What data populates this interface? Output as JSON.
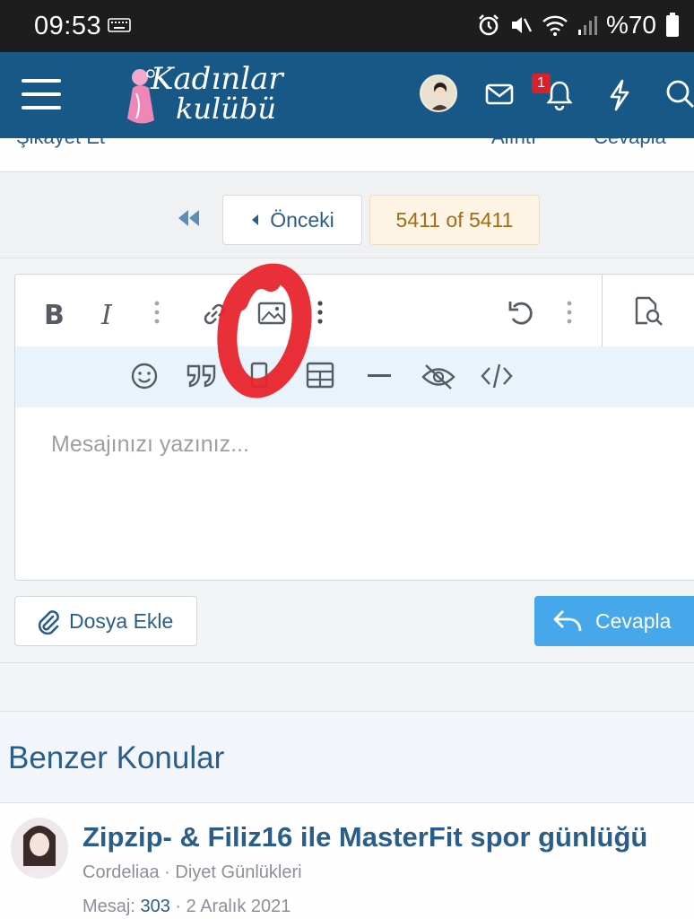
{
  "status_bar": {
    "time": "09:53",
    "battery_text": "%70",
    "icons": [
      "keyboard-icon",
      "alarm-icon",
      "mute-icon",
      "wifi-icon",
      "signal-icon",
      "battery-icon"
    ]
  },
  "header": {
    "logo_line1": "Kadınlar",
    "logo_line2": "kulübü",
    "notification_count": "1",
    "colors": {
      "background": "#185886",
      "badge": "#d9212c"
    }
  },
  "post_footer": {
    "report_label": "Şikayet Et",
    "quote_label": "Alıntı",
    "reply_label": "Cevapla"
  },
  "pagination": {
    "prev_label": "Önceki",
    "page_count": "5411 of 5411"
  },
  "editor": {
    "placeholder": "Mesajınızı yazınız...",
    "toolbar_row1": [
      "bold-icon",
      "italic-icon",
      "more-vertical-icon",
      "link-icon",
      "image-icon",
      "more-vertical-icon",
      "undo-icon",
      "more-vertical-icon",
      "preview-icon"
    ],
    "toolbar_row2": [
      "smiley-icon",
      "quote-icon",
      "media-icon",
      "table-icon",
      "horizontal-rule-icon",
      "spoiler-icon",
      "code-icon"
    ]
  },
  "actions": {
    "attach_label": "Dosya Ekle",
    "reply_label": "Cevapla",
    "reply_color": "#47a7eb"
  },
  "similar_threads": {
    "title": "Benzer Konular",
    "items": [
      {
        "title": "Zipzip- & Filiz16 ile MasterFit spor günlüğü",
        "author": "Cordeliaa",
        "forum": "Diyet Günlükleri",
        "messages_label": "Mesaj:",
        "messages": "303",
        "date": "2 Aralık 2021"
      }
    ]
  },
  "annotation": {
    "color": "#e8242c"
  }
}
